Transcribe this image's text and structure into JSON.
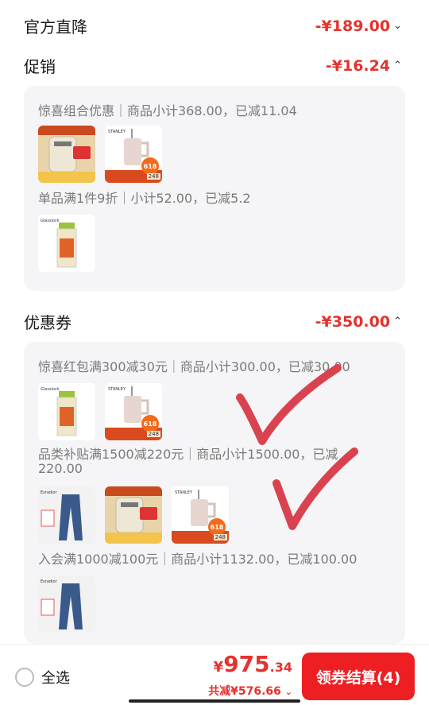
{
  "official": {
    "label": "官方直降",
    "amount": "-¥189.00"
  },
  "promo": {
    "label": "促销",
    "amount": "-¥16.24",
    "groups": [
      {
        "desc": "惊喜组合优惠｜商品小计368.00，已减11.04",
        "items": [
          "kettle",
          "tumbler"
        ]
      },
      {
        "desc": "单品满1件9折｜小计52.00，已减5.2",
        "items": [
          "jar"
        ]
      }
    ]
  },
  "coupon": {
    "label": "优惠券",
    "amount": "-¥350.00",
    "groups": [
      {
        "desc": "惊喜红包满300减30元｜商品小计300.00，已减30.00",
        "items": [
          "jar",
          "tumbler"
        ]
      },
      {
        "desc_line1": "品类补贴满1500减220元｜商品小计1500.00，已减",
        "desc_line2": "220.00",
        "items": [
          "jeans",
          "kettle",
          "tumbler"
        ]
      },
      {
        "desc": "入会满1000减100元｜商品小计1132.00，已减100.00",
        "items": [
          "jeans"
        ]
      }
    ]
  },
  "thumbs": {
    "brand_tumbler": "STANLEY",
    "badge": "618",
    "price_tag": "248",
    "brand_jar": "Glasslock",
    "brand_jeans": "Esradior"
  },
  "footer": {
    "select_all": "全选",
    "currency": "¥",
    "total_int": "975",
    "total_dec": ".34",
    "saved": "共减¥576.66",
    "pay_button": "领券结算(4)"
  },
  "colors": {
    "accent": "#e5322d",
    "button": "#ee1f23",
    "panel": "#f5f5f7"
  }
}
